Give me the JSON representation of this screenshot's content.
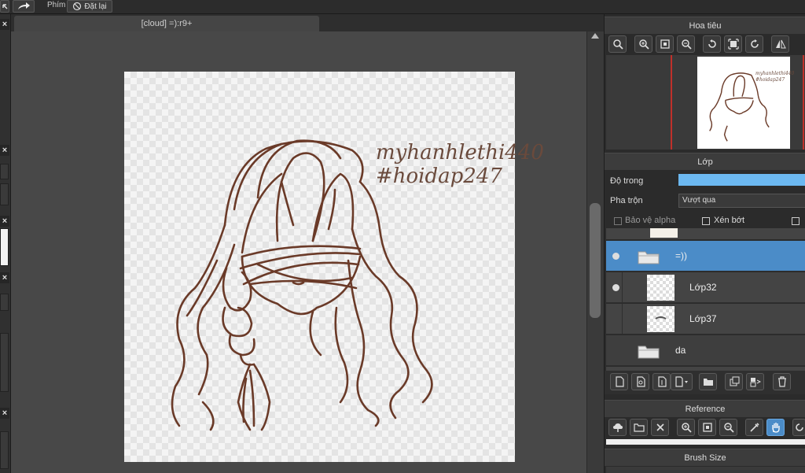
{
  "toolbar": {
    "phim_label": "Phím",
    "reset_label": "Đặt lại"
  },
  "document": {
    "tab_title": "[cloud] =):r9+"
  },
  "canvas_text": {
    "line1": "myhanhlethi440",
    "line2": "#hoidap247"
  },
  "navigator": {
    "title": "Hoa tiêu",
    "thumb_line1": "myhanhlethi440",
    "thumb_line2": "#hoidap247"
  },
  "layers": {
    "title": "Lớp",
    "opacity_label": "Độ trong",
    "blend_label": "Pha trộn",
    "blend_value": "Vượt qua",
    "protect_alpha_label": "Bảo vệ alpha",
    "clipping_label": "Xén bớt",
    "items": [
      {
        "name": "=))",
        "type": "folder",
        "selected": true
      },
      {
        "name": "Lớp32",
        "type": "layer",
        "selected": false
      },
      {
        "name": "Lớp37",
        "type": "layer",
        "selected": false
      },
      {
        "name": "da",
        "type": "folder",
        "selected": false
      }
    ]
  },
  "reference": {
    "title": "Reference"
  },
  "brush_size": {
    "title": "Brush Size"
  },
  "colors": {
    "accent": "#4b8cc8",
    "line_art": "#6a3a28",
    "opacity_bar": "#6cb8f0"
  }
}
